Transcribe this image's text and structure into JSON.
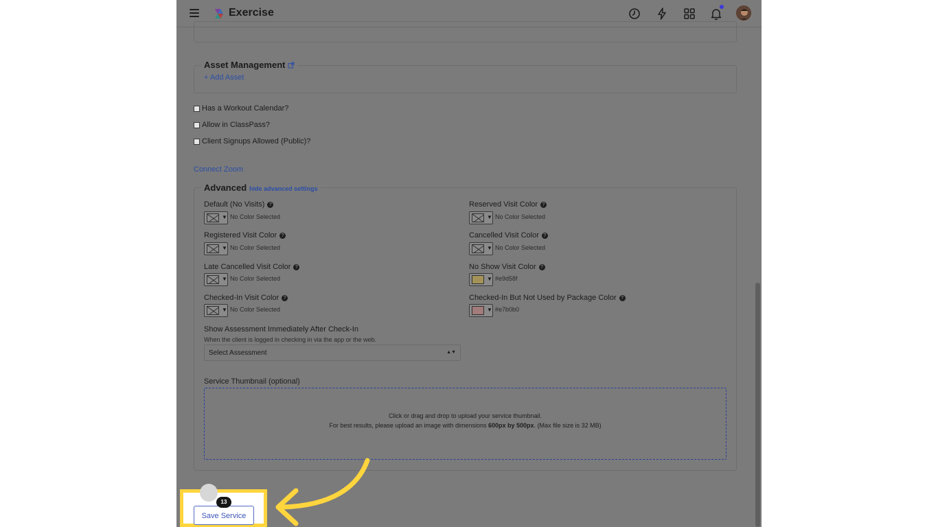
{
  "header": {
    "app_title": "Exercise",
    "icons": [
      "menu-icon",
      "clock-icon",
      "bolt-icon",
      "apps-grid-icon",
      "bell-icon"
    ]
  },
  "asset_management": {
    "legend": "Asset Management",
    "add_asset_label": "+ Add Asset"
  },
  "checkboxes": [
    {
      "label": "Has a Workout Calendar?",
      "checked": false
    },
    {
      "label": "Allow in ClassPass?",
      "checked": false
    },
    {
      "label": "Client Signups Allowed (Public)?",
      "checked": false
    }
  ],
  "connect_zoom_label": "Connect Zoom",
  "advanced": {
    "legend": "Advanced",
    "toggle_label": "hide advanced settings",
    "colors": {
      "default": {
        "label": "Default (No Visits)",
        "value": "No Color Selected"
      },
      "reserved": {
        "label": "Reserved Visit Color",
        "value": "No Color Selected"
      },
      "registered": {
        "label": "Registered Visit Color",
        "value": "No Color Selected"
      },
      "cancelled": {
        "label": "Cancelled Visit Color",
        "value": "No Color Selected"
      },
      "late_cancelled": {
        "label": "Late Cancelled Visit Color",
        "value": "No Color Selected"
      },
      "no_show": {
        "label": "No Show Visit Color",
        "value": "#e9d58f",
        "swatch": "#a49359"
      },
      "checked_in": {
        "label": "Checked-In Visit Color",
        "value": "No Color Selected"
      },
      "checked_in_not_used": {
        "label": "Checked-In But Not Used by Package Color",
        "value": "#e7b0b0",
        "swatch": "#a27b7b"
      }
    },
    "assessment": {
      "label": "Show Assessment Immediately After Check-In",
      "help": "When the client is logged in checking in via the app or the web.",
      "selected": "Select Assessment"
    },
    "thumbnail": {
      "label": "Service Thumbnail (optional)",
      "line1": "Click or drag and drop to upload your service thumbnail.",
      "line2_prefix": "For best results, please upload an image with dimensions ",
      "line2_bold": "600px by 500px",
      "line2_suffix": ". (Max file size is 32 MB)"
    }
  },
  "footer": {
    "save_label": "Save Service",
    "badge_count": "13"
  },
  "colors": {
    "overlay_bg": "#7b7b7b",
    "link": "#2c4ea6",
    "highlight": "#ffd53e",
    "save_button_text": "#3d55b8"
  }
}
